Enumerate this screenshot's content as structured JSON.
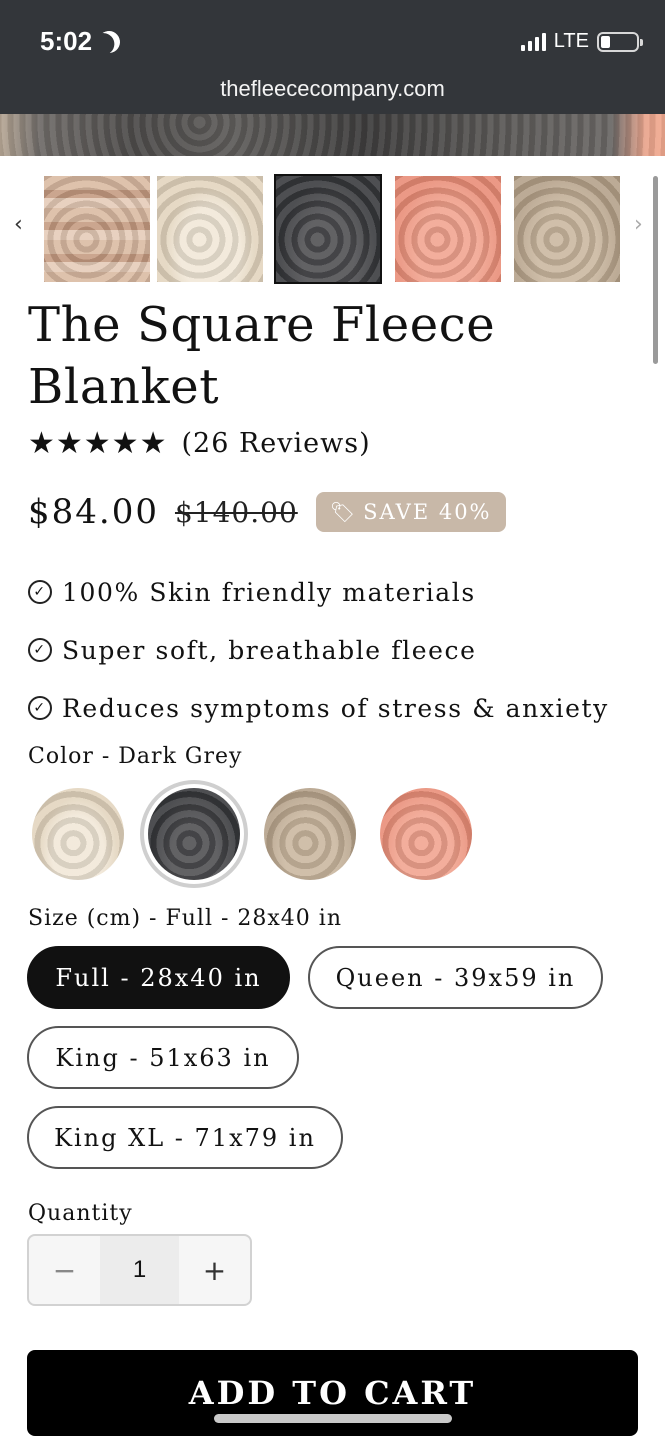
{
  "status_bar": {
    "time": "5:02",
    "network": "LTE"
  },
  "browser": {
    "url": "thefleececompany.com"
  },
  "gallery": {
    "prev_arrow": "‹",
    "next_arrow": "›",
    "thumbnails": [
      "tan",
      "cream",
      "dark-grey",
      "pink",
      "beige"
    ],
    "selected_index": 2
  },
  "product": {
    "title": "The Square Fleece Blanket",
    "stars": "★★★★★",
    "rating": 5,
    "reviews": "(26 Reviews)",
    "price": "$84.00",
    "compare_price": "$140.00",
    "badge": "SAVE 40%",
    "features": [
      "100% Skin friendly materials",
      "Super soft, breathable fleece",
      "Reduces symptoms of stress & anxiety"
    ]
  },
  "color_option": {
    "label": "Color - Dark Grey",
    "swatches": [
      "cream",
      "dark-grey",
      "beige",
      "pink"
    ],
    "selected": "dark-grey"
  },
  "size_option": {
    "label": "Size (cm) - Full - 28x40 in",
    "sizes": [
      "Full - 28x40 in",
      "Queen - 39x59 in",
      "King - 51x63 in",
      "King XL - 71x79 in"
    ],
    "selected_index": 0
  },
  "quantity": {
    "label": "Quantity",
    "minus": "−",
    "value": "1",
    "plus": "+"
  },
  "cta": {
    "add_to_cart": "ADD TO CART"
  }
}
